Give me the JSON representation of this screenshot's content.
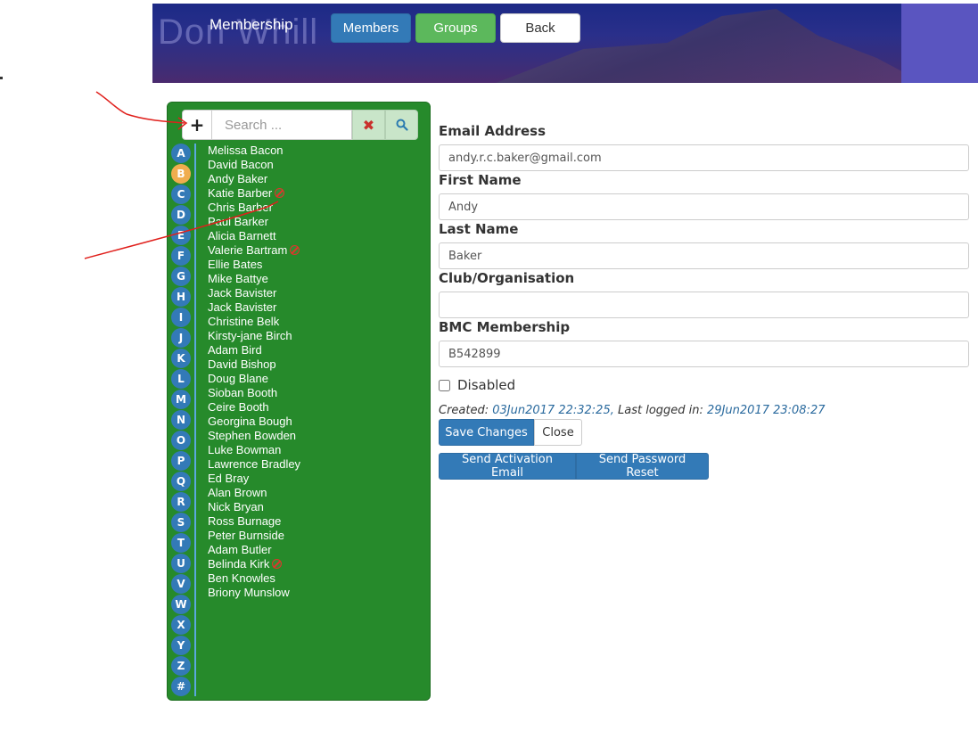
{
  "header": {
    "faint_title": "Don Whill",
    "title": "Membership",
    "buttons": {
      "members": "Members",
      "groups": "Groups",
      "back": "Back"
    }
  },
  "search": {
    "add_symbol": "+",
    "placeholder": "Search ...",
    "clear_symbol": "✖",
    "search_symbol": "🔍︎"
  },
  "letters": [
    "A",
    "B",
    "C",
    "D",
    "E",
    "F",
    "G",
    "H",
    "I",
    "J",
    "K",
    "L",
    "M",
    "N",
    "O",
    "P",
    "Q",
    "R",
    "S",
    "T",
    "U",
    "V",
    "W",
    "X",
    "Y",
    "Z",
    "#"
  ],
  "active_letter": "B",
  "members": [
    {
      "name": "Melissa Bacon",
      "disabled": false
    },
    {
      "name": "David Bacon",
      "disabled": false
    },
    {
      "name": "Andy Baker",
      "disabled": false
    },
    {
      "name": "Katie Barber",
      "disabled": true
    },
    {
      "name": "Chris Barber",
      "disabled": false
    },
    {
      "name": "Paul Barker",
      "disabled": false
    },
    {
      "name": "Alicia Barnett",
      "disabled": false
    },
    {
      "name": "Valerie Bartram",
      "disabled": true
    },
    {
      "name": "Ellie Bates",
      "disabled": false
    },
    {
      "name": "Mike Battye",
      "disabled": false
    },
    {
      "name": "Jack Bavister",
      "disabled": false
    },
    {
      "name": "Jack Bavister",
      "disabled": false
    },
    {
      "name": "Christine Belk",
      "disabled": false
    },
    {
      "name": "Kirsty-jane Birch",
      "disabled": false
    },
    {
      "name": "Adam Bird",
      "disabled": false
    },
    {
      "name": "David Bishop",
      "disabled": false
    },
    {
      "name": "Doug Blane",
      "disabled": false
    },
    {
      "name": "Sioban Booth",
      "disabled": false
    },
    {
      "name": "Ceire Booth",
      "disabled": false
    },
    {
      "name": "Georgina Bough",
      "disabled": false
    },
    {
      "name": "Stephen Bowden",
      "disabled": false
    },
    {
      "name": "Luke Bowman",
      "disabled": false
    },
    {
      "name": "Lawrence Bradley",
      "disabled": false
    },
    {
      "name": "Ed Bray",
      "disabled": false
    },
    {
      "name": "Alan Brown",
      "disabled": false
    },
    {
      "name": "Nick Bryan",
      "disabled": false
    },
    {
      "name": "Ross Burnage",
      "disabled": false
    },
    {
      "name": "Peter Burnside",
      "disabled": false
    },
    {
      "name": "Adam Butler",
      "disabled": false
    },
    {
      "name": "Belinda Kirk",
      "disabled": true
    },
    {
      "name": "Ben Knowles",
      "disabled": false
    },
    {
      "name": "Briony Munslow",
      "disabled": false
    }
  ],
  "form": {
    "email_label": "Email Address",
    "email_value": "andy.r.c.baker@gmail.com",
    "first_name_label": "First Name",
    "first_name_value": "Andy",
    "last_name_label": "Last Name",
    "last_name_value": "Baker",
    "club_label": "Club/Organisation",
    "club_value": "",
    "bmc_label": "BMC Membership",
    "bmc_value": "B542899",
    "disabled_label": "Disabled",
    "disabled_checked": false,
    "created_label": "Created:",
    "created_value": "03Jun2017 22:32:25,",
    "last_logged_label": "Last logged in:",
    "last_logged_value": "29Jun2017 23:08:27",
    "save_label": "Save Changes",
    "close_label": "Close",
    "activation_label": "Send Activation Email",
    "reset_label": "Send Password Reset"
  },
  "colors": {
    "panel_green": "#268a2b",
    "primary_blue": "#337ab7",
    "success_green": "#5cb85c",
    "active_letter": "#f0ad4e",
    "annotation_red": "#e0201c"
  }
}
